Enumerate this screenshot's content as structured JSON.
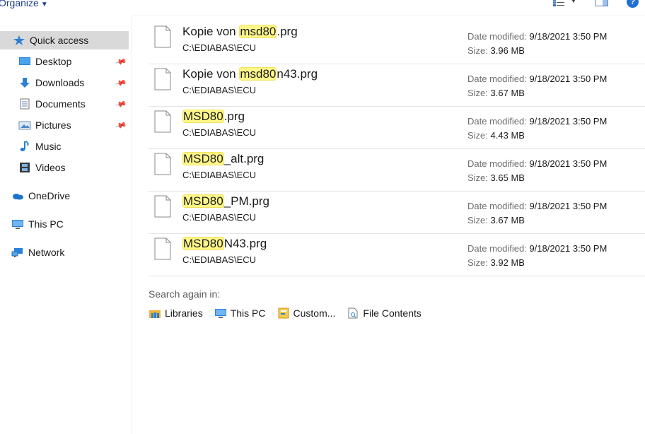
{
  "toolbar": {
    "organize_label": "Organize",
    "organize_caret": "▼",
    "view_icon": "details-view-icon",
    "view_caret": "▼",
    "pane_icon": "preview-pane-icon",
    "help_glyph": "?"
  },
  "nav": {
    "items": [
      {
        "label": "Quick access",
        "icon": "star-icon",
        "pinned": false,
        "selected": true
      },
      {
        "label": "Desktop",
        "icon": "desktop-icon",
        "pinned": true
      },
      {
        "label": "Downloads",
        "icon": "download-arrow-icon",
        "pinned": true
      },
      {
        "label": "Documents",
        "icon": "document-icon",
        "pinned": true
      },
      {
        "label": "Pictures",
        "icon": "pictures-icon",
        "pinned": true
      },
      {
        "label": "Music",
        "icon": "music-note-icon",
        "pinned": false
      },
      {
        "label": "Videos",
        "icon": "film-icon",
        "pinned": false
      },
      {
        "label": "OneDrive",
        "icon": "cloud-icon",
        "pinned": false
      },
      {
        "label": "This PC",
        "icon": "computer-icon",
        "pinned": false
      },
      {
        "label": "Network",
        "icon": "network-icon",
        "pinned": false
      }
    ]
  },
  "results": [
    {
      "prefix": "Kopie von ",
      "match": "msd80",
      "suffix": ".prg",
      "path": "C:\\EDIABAS\\ECU",
      "date_label": "Date modified:",
      "date": "9/18/2021 3:50 PM",
      "size_label": "Size:",
      "size": "3.96 MB"
    },
    {
      "prefix": "Kopie von ",
      "match": "msd80",
      "suffix": "n43.prg",
      "path": "C:\\EDIABAS\\ECU",
      "date_label": "Date modified:",
      "date": "9/18/2021 3:50 PM",
      "size_label": "Size:",
      "size": "3.67 MB"
    },
    {
      "prefix": "",
      "match": "MSD80",
      "suffix": ".prg",
      "path": "C:\\EDIABAS\\ECU",
      "date_label": "Date modified:",
      "date": "9/18/2021 3:50 PM",
      "size_label": "Size:",
      "size": "4.43 MB"
    },
    {
      "prefix": "",
      "match": "MSD80",
      "suffix": "_alt.prg",
      "path": "C:\\EDIABAS\\ECU",
      "date_label": "Date modified:",
      "date": "9/18/2021 3:50 PM",
      "size_label": "Size:",
      "size": "3.65 MB"
    },
    {
      "prefix": "",
      "match": "MSD80",
      "suffix": "_PM.prg",
      "path": "C:\\EDIABAS\\ECU",
      "date_label": "Date modified:",
      "date": "9/18/2021 3:50 PM",
      "size_label": "Size:",
      "size": "3.67 MB"
    },
    {
      "prefix": "",
      "match": "MSD80",
      "suffix": "N43.prg",
      "path": "C:\\EDIABAS\\ECU",
      "date_label": "Date modified:",
      "date": "9/18/2021 3:50 PM",
      "size_label": "Size:",
      "size": "3.92 MB"
    }
  ],
  "search_again": {
    "label": "Search again in:",
    "links": [
      {
        "label": "Libraries",
        "icon": "libraries-icon"
      },
      {
        "label": "This PC",
        "icon": "computer-icon"
      },
      {
        "label": "Custom...",
        "icon": "custom-folder-icon"
      },
      {
        "label": "File Contents",
        "icon": "file-contents-icon"
      }
    ]
  },
  "colors": {
    "accent": "#1e3f8a",
    "highlight": "#fff78a",
    "nav_selected": "#d9d9d9",
    "help": "#1f6fd6"
  }
}
